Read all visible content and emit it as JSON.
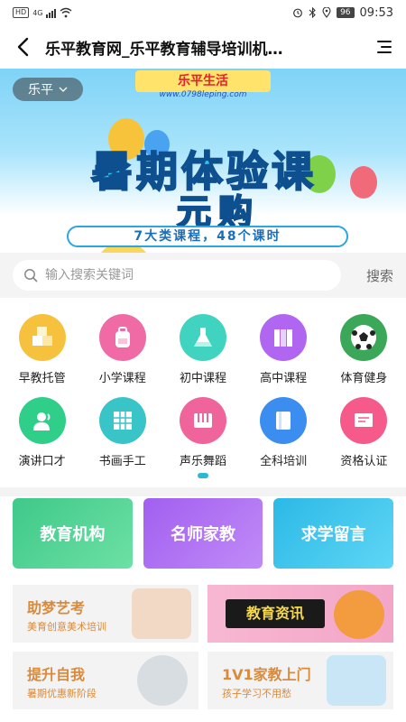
{
  "status_bar": {
    "network_badge": "HD",
    "signal_label": "4G",
    "battery": "96",
    "time": "09:53"
  },
  "header": {
    "title": "乐平教育网_乐平教育辅导培训机…"
  },
  "banner": {
    "city": "乐平",
    "logo_text": "乐平生活",
    "url_text": "www.0798leping.com",
    "headline_line1": "暑期体验课",
    "headline_line2": "元购",
    "subtitle": "7大类课程，48个课时"
  },
  "search": {
    "placeholder": "输入搜索关键词",
    "button_label": "搜索"
  },
  "categories": [
    {
      "label": "早教托管",
      "icon": "blocks-icon",
      "color": "#f6c23d"
    },
    {
      "label": "小学课程",
      "icon": "backpack-icon",
      "color": "#f06aa6"
    },
    {
      "label": "初中课程",
      "icon": "flask-icon",
      "color": "#3fd3c0"
    },
    {
      "label": "高中课程",
      "icon": "books-icon",
      "color": "#b066f0"
    },
    {
      "label": "体育健身",
      "icon": "soccer-ball-icon",
      "color": "#3aa858"
    },
    {
      "label": "演讲口才",
      "icon": "speaker-icon",
      "color": "#2fcf8a"
    },
    {
      "label": "书画手工",
      "icon": "grid-icon",
      "color": "#39c4c8"
    },
    {
      "label": "声乐舞蹈",
      "icon": "piano-icon",
      "color": "#f0649c"
    },
    {
      "label": "全科培训",
      "icon": "book-icon",
      "color": "#3b8ef0"
    },
    {
      "label": "资格认证",
      "icon": "certificate-icon",
      "color": "#f55a8a"
    }
  ],
  "big_buttons": [
    {
      "label": "教育机构",
      "color_a": "#3ec98a",
      "color_b": "#6ee0a4"
    },
    {
      "label": "名师家教",
      "color_a": "#a25ff0",
      "color_b": "#c08bf7"
    },
    {
      "label": "求学留言",
      "color_a": "#2bb9e6",
      "color_b": "#5fd6f5"
    }
  ],
  "promos": [
    {
      "title": "助梦艺考",
      "subtitle": "美育创意美术培训",
      "pic": "student-girl-image",
      "pic_color": "#f2d9c6"
    },
    {
      "title": "",
      "subtitle": "",
      "pic": "education-news-image",
      "pic_color": "#f3a6c8",
      "overlay": "教育资讯"
    },
    {
      "title": "提升自我",
      "subtitle": "暑期优惠新阶段",
      "pic": "stopwatch-image",
      "pic_color": "#d8dde2"
    },
    {
      "title": "1V1家教上门",
      "subtitle": "孩子学习不用愁",
      "pic": "tutor-image",
      "pic_color": "#c9e6f7"
    }
  ]
}
